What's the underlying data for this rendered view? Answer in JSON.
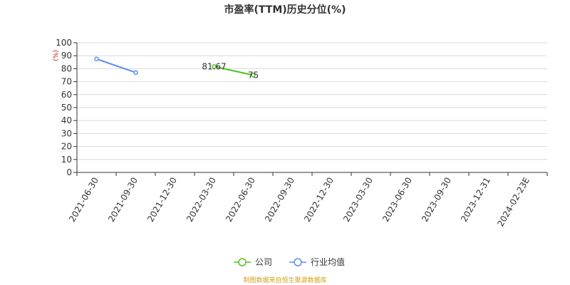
{
  "chart_data": {
    "type": "line",
    "title": "市盈率(TTM)历史分位(%)",
    "unit_label": "(%)",
    "categories": [
      "2021-06-30",
      "2021-09-30",
      "2021-12-30",
      "2022-03-30",
      "2022-06-30",
      "2022-09-30",
      "2022-12-30",
      "2023-03-30",
      "2023-06-30",
      "2023-09-30",
      "2023-12-31",
      "2024-02-23E"
    ],
    "ylim": [
      0,
      100
    ],
    "yticks": [
      0,
      10,
      20,
      30,
      40,
      50,
      60,
      70,
      80,
      90,
      100
    ],
    "grid": true,
    "legend_position": "bottom",
    "series": [
      {
        "name": "公司",
        "color": "#52c41a",
        "values": [
          null,
          null,
          null,
          81.67,
          75,
          null,
          null,
          null,
          null,
          null,
          null,
          null
        ],
        "labels": [
          null,
          null,
          null,
          "81.67",
          "75",
          null,
          null,
          null,
          null,
          null,
          null,
          null
        ]
      },
      {
        "name": "行业均值",
        "color": "#5b8ff9",
        "values": [
          87.5,
          77,
          null,
          null,
          null,
          null,
          null,
          null,
          null,
          null,
          null,
          null
        ],
        "labels": [
          null,
          null,
          null,
          null,
          null,
          null,
          null,
          null,
          null,
          null,
          null,
          null
        ]
      }
    ]
  },
  "colors": {
    "unit_label": "#e00000",
    "source": "#d4a017",
    "axis": "#333333",
    "grid": "#d9d9d9"
  },
  "source_text": "制图数据来自恒生聚源数据库"
}
